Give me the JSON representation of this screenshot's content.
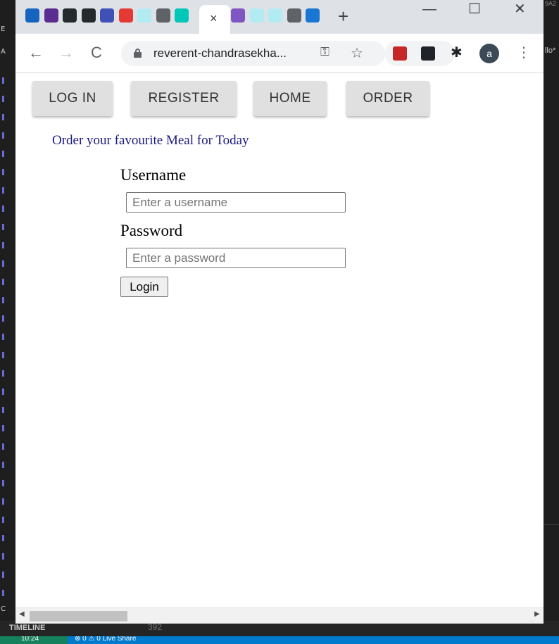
{
  "editor": {
    "left_letters": [
      "E",
      "A",
      "C"
    ],
    "right_fragment": "llo*",
    "right_top_fragment": "9A2",
    "timeline_label": "TIMELINE",
    "timeline_number": "392",
    "status_left": "10:24",
    "status_middle": "⊗ 0 ⚠ 0   Live Share"
  },
  "browser": {
    "tab_favicons": [
      {
        "name": "tab-favicon-1",
        "color": "#1565c0"
      },
      {
        "name": "tab-favicon-ed",
        "color": "#5c2d91"
      },
      {
        "name": "tab-favicon-github-1",
        "color": "#24292e"
      },
      {
        "name": "tab-favicon-github-2",
        "color": "#24292e"
      },
      {
        "name": "tab-favicon-b",
        "color": "#3f51b5"
      },
      {
        "name": "tab-favicon-kanban",
        "color": "#e53935"
      },
      {
        "name": "tab-favicon-globe-1",
        "color": "#b2ebf2"
      },
      {
        "name": "tab-favicon-chrome-1",
        "color": "#5f6368"
      },
      {
        "name": "tab-favicon-check",
        "color": "#00c7b7"
      }
    ],
    "tab_favicons_after": [
      {
        "name": "tab-favicon-h",
        "color": "#7e57c2"
      },
      {
        "name": "tab-favicon-globe-2",
        "color": "#b2ebf2"
      },
      {
        "name": "tab-favicon-globe-3",
        "color": "#b2ebf2"
      },
      {
        "name": "tab-favicon-chrome-2",
        "color": "#5f6368"
      },
      {
        "name": "tab-favicon-t",
        "color": "#1976d2"
      }
    ],
    "active_tab_close": "×",
    "new_tab": "+",
    "window_controls": {
      "minimize": "—",
      "maximize": "☐",
      "close": "✕"
    },
    "nav": {
      "back": "←",
      "forward": "→",
      "reload": "C"
    },
    "address": "reverent-chandrasekha...",
    "key_icon": "⚿",
    "star_icon": "☆",
    "extensions": [
      {
        "name": "ublock-extension-icon",
        "color": "#c62828"
      },
      {
        "name": "react-devtools-extension-icon",
        "color": "#20232a"
      }
    ],
    "puzzle_icon": "✱",
    "profile_initial": "a",
    "menu_icon": "⋮"
  },
  "page": {
    "nav_buttons": [
      "LOG IN",
      "REGISTER",
      "HOME",
      "ORDER"
    ],
    "heading": "Order your favourite Meal for Today",
    "form": {
      "username_label": "Username",
      "username_placeholder": "Enter a username",
      "password_label": "Password",
      "password_placeholder": "Enter a password",
      "submit_label": "Login"
    }
  },
  "colors": {
    "heading": "#1a1a80",
    "nav_button_bg": "#e0e0e0",
    "tabstrip_bg": "#dee1e6",
    "statusbar_bg": "#007acc"
  }
}
